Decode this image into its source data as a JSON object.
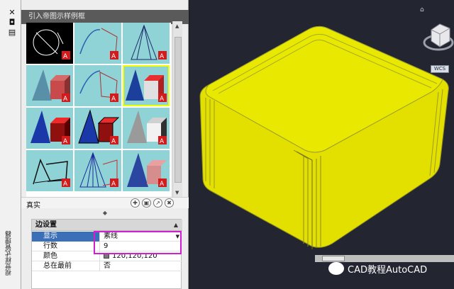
{
  "palette": {
    "title": "引入帝图示样例框",
    "close_glyph": "✕",
    "vertical_label": "视觉样式管理器",
    "current_style_label": "真实",
    "tool_icons": [
      "create-style-icon",
      "apply-style-icon",
      "export-style-icon",
      "delete-style-icon"
    ]
  },
  "properties": {
    "section_title": "边设置",
    "rows": [
      {
        "key": "显示",
        "value": "素线"
      },
      {
        "key": "行数",
        "value": "9"
      },
      {
        "key": "颜色",
        "value": "120,120,120"
      },
      {
        "key": "总在最前",
        "value": "否"
      }
    ]
  },
  "viewport": {
    "wcs_label": "WCS",
    "watermark": "CAD教程AutoCAD"
  },
  "colors": {
    "accent_selected": "#f0ff00",
    "highlight_box": "#d11ed1",
    "model_fill": "#e3e000",
    "viewport_bg": "#232630"
  }
}
